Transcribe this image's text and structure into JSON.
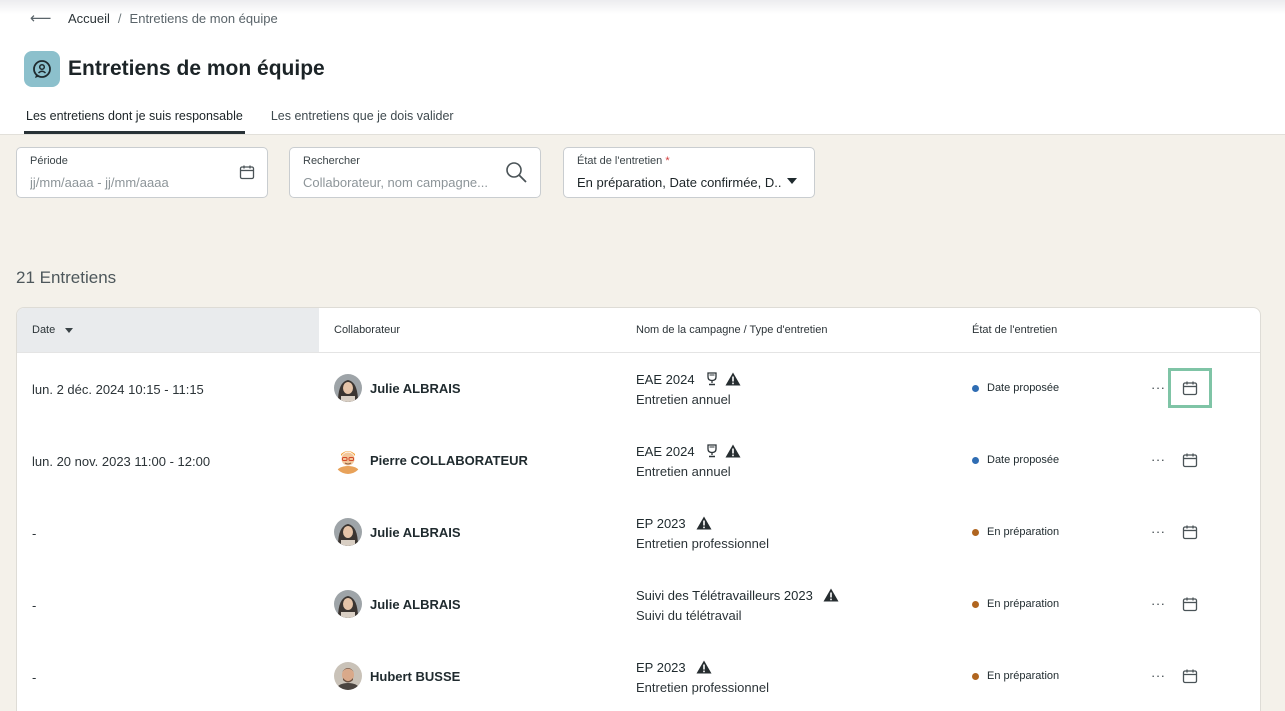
{
  "breadcrumb": {
    "home": "Accueil",
    "separator": "/",
    "current": "Entretiens de mon équipe"
  },
  "page": {
    "title": "Entretiens de mon équipe",
    "title_icon": "person-chat-icon"
  },
  "tabs": [
    {
      "label": "Les entretiens dont je suis responsable",
      "active": true
    },
    {
      "label": "Les entretiens que je dois valider",
      "active": false
    }
  ],
  "filters": {
    "period": {
      "label": "Période",
      "placeholder": "jj/mm/aaaa - jj/mm/aaaa",
      "icon": "calendar-icon"
    },
    "search": {
      "label": "Rechercher",
      "placeholder": "Collaborateur, nom campagne...",
      "icon": "search-icon"
    },
    "state": {
      "label": "État de l'entretien",
      "required_mark": "*",
      "value": "En préparation, Date confirmée, D...",
      "icon": "caret-down-icon"
    }
  },
  "count_label": "21 Entretiens",
  "table": {
    "columns": {
      "date": "Date",
      "collaborator": "Collaborateur",
      "campaign": "Nom de la campagne / Type d'entretien",
      "state": "État de l'entretien"
    },
    "more_label": "···",
    "rows": [
      {
        "date": "lun. 2 déc. 2024 10:15 - 11:15",
        "collaborator": "Julie ALBRAIS",
        "avatar": "woman",
        "campaign": "EAE 2024",
        "type": "Entretien annuel",
        "trophy": true,
        "warning": true,
        "status": "Date proposée",
        "status_color": "#2f6db3"
      },
      {
        "date": "lun. 20 nov. 2023 11:00 - 12:00",
        "collaborator": "Pierre COLLABORATEUR",
        "avatar": "cartoon",
        "campaign": "EAE 2024",
        "type": "Entretien annuel",
        "trophy": true,
        "warning": true,
        "status": "Date proposée",
        "status_color": "#2f6db3"
      },
      {
        "date": "-",
        "collaborator": "Julie ALBRAIS",
        "avatar": "woman",
        "campaign": "EP 2023",
        "type": "Entretien professionnel",
        "trophy": false,
        "warning": true,
        "status": "En préparation",
        "status_color": "#b0651f"
      },
      {
        "date": "-",
        "collaborator": "Julie ALBRAIS",
        "avatar": "woman",
        "campaign": "Suivi des Télétravailleurs 2023",
        "type": "Suivi du télétravail",
        "trophy": false,
        "warning": true,
        "status": "En préparation",
        "status_color": "#b0651f"
      },
      {
        "date": "-",
        "collaborator": "Hubert BUSSE",
        "avatar": "man",
        "campaign": "EP 2023",
        "type": "Entretien professionnel",
        "trophy": false,
        "warning": true,
        "status": "En préparation",
        "status_color": "#b0651f"
      }
    ]
  }
}
